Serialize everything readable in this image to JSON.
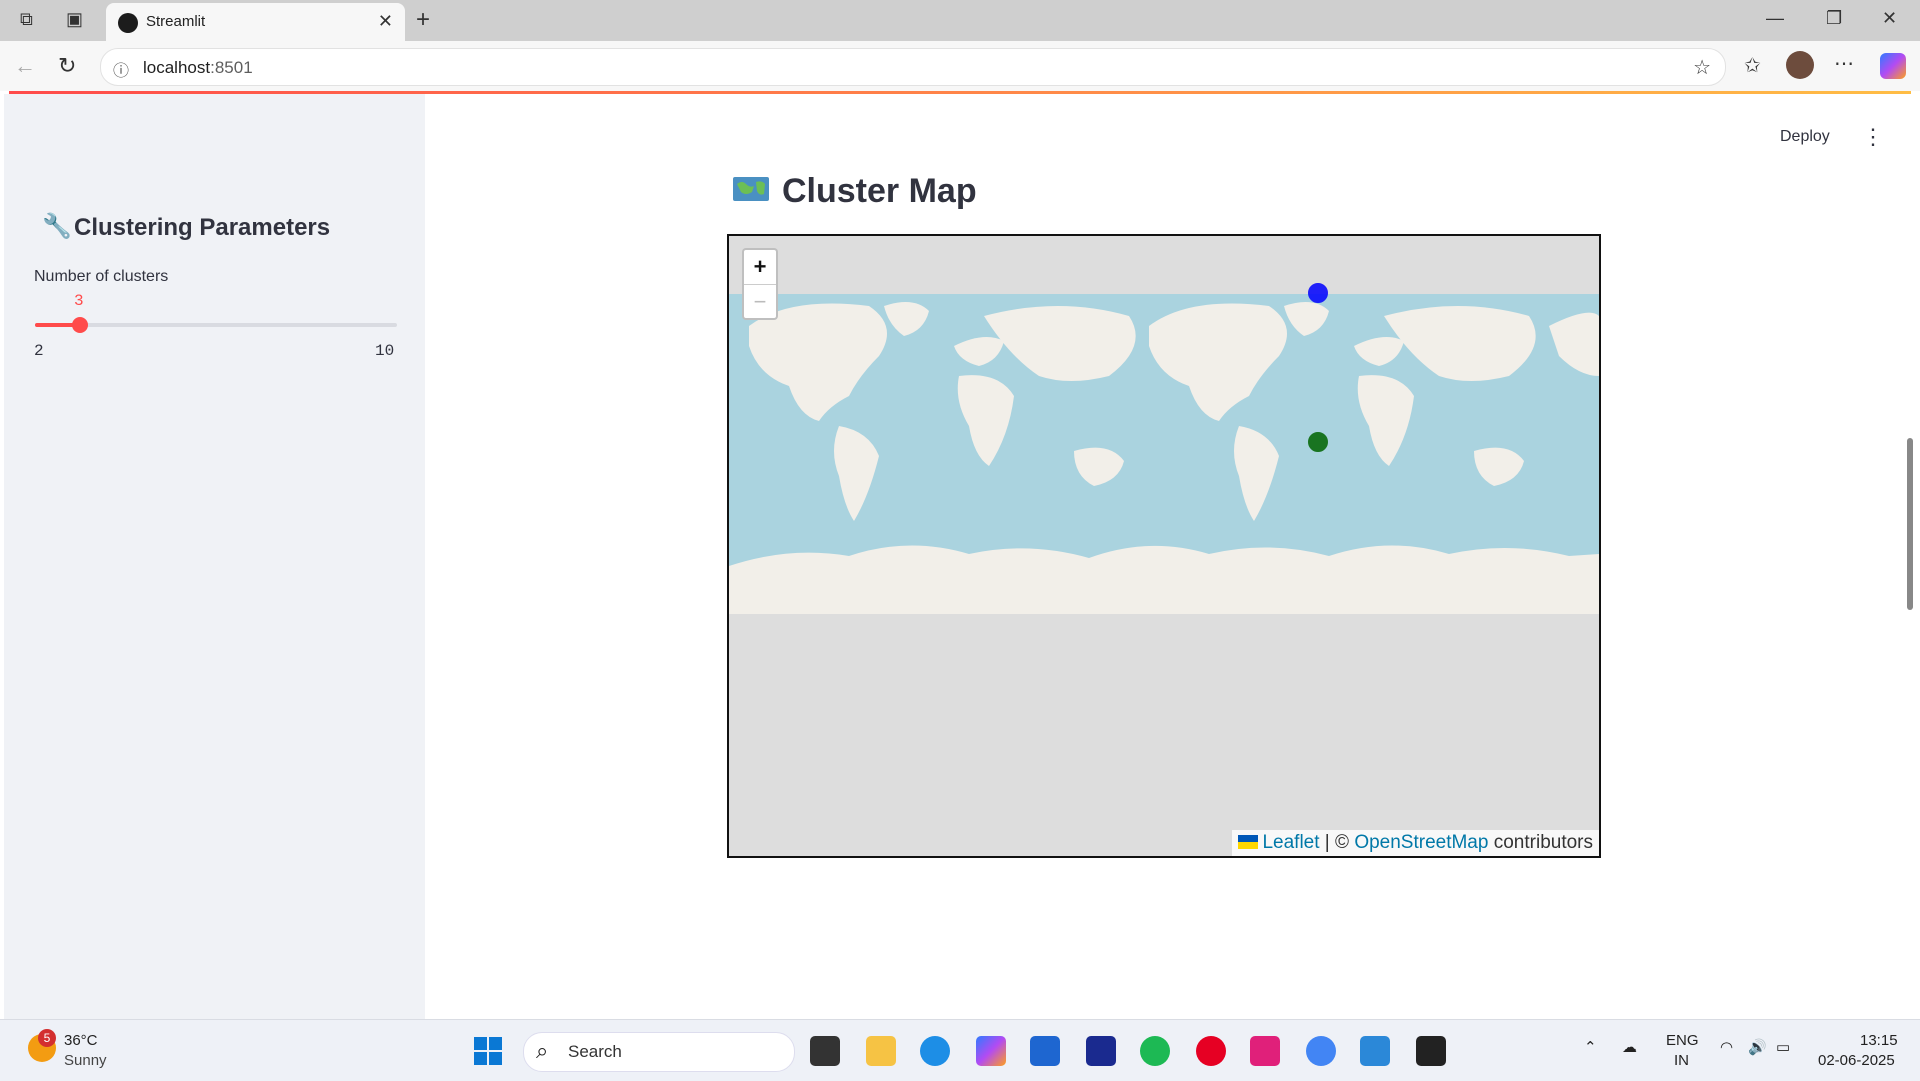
{
  "browser": {
    "tab_title": "Streamlit",
    "url_host": "localhost",
    "url_port": ":8501"
  },
  "sidebar": {
    "title": "Clustering Parameters",
    "slider": {
      "label": "Number of clusters",
      "value": "3",
      "min": "2",
      "max": "10"
    }
  },
  "header": {
    "deploy_label": "Deploy"
  },
  "main": {
    "heading": "Cluster Map",
    "map": {
      "zoom_in": "+",
      "zoom_out": "−",
      "attribution_leaflet": "Leaflet",
      "attribution_sep": " | © ",
      "attribution_osm": "OpenStreetMap",
      "attribution_tail": " contributors",
      "markers": [
        {
          "color": "#0000ff"
        },
        {
          "color": "#006400"
        }
      ]
    }
  },
  "taskbar": {
    "weather_badge": "5",
    "temperature": "36°C",
    "condition": "Sunny",
    "search_label": "Search",
    "language": "ENG",
    "region": "IN",
    "time": "13:15",
    "date": "02-06-2025"
  },
  "colors": {
    "accent": "#ff4b4b",
    "ocean": "#aad3df",
    "land": "#f2efe9"
  }
}
